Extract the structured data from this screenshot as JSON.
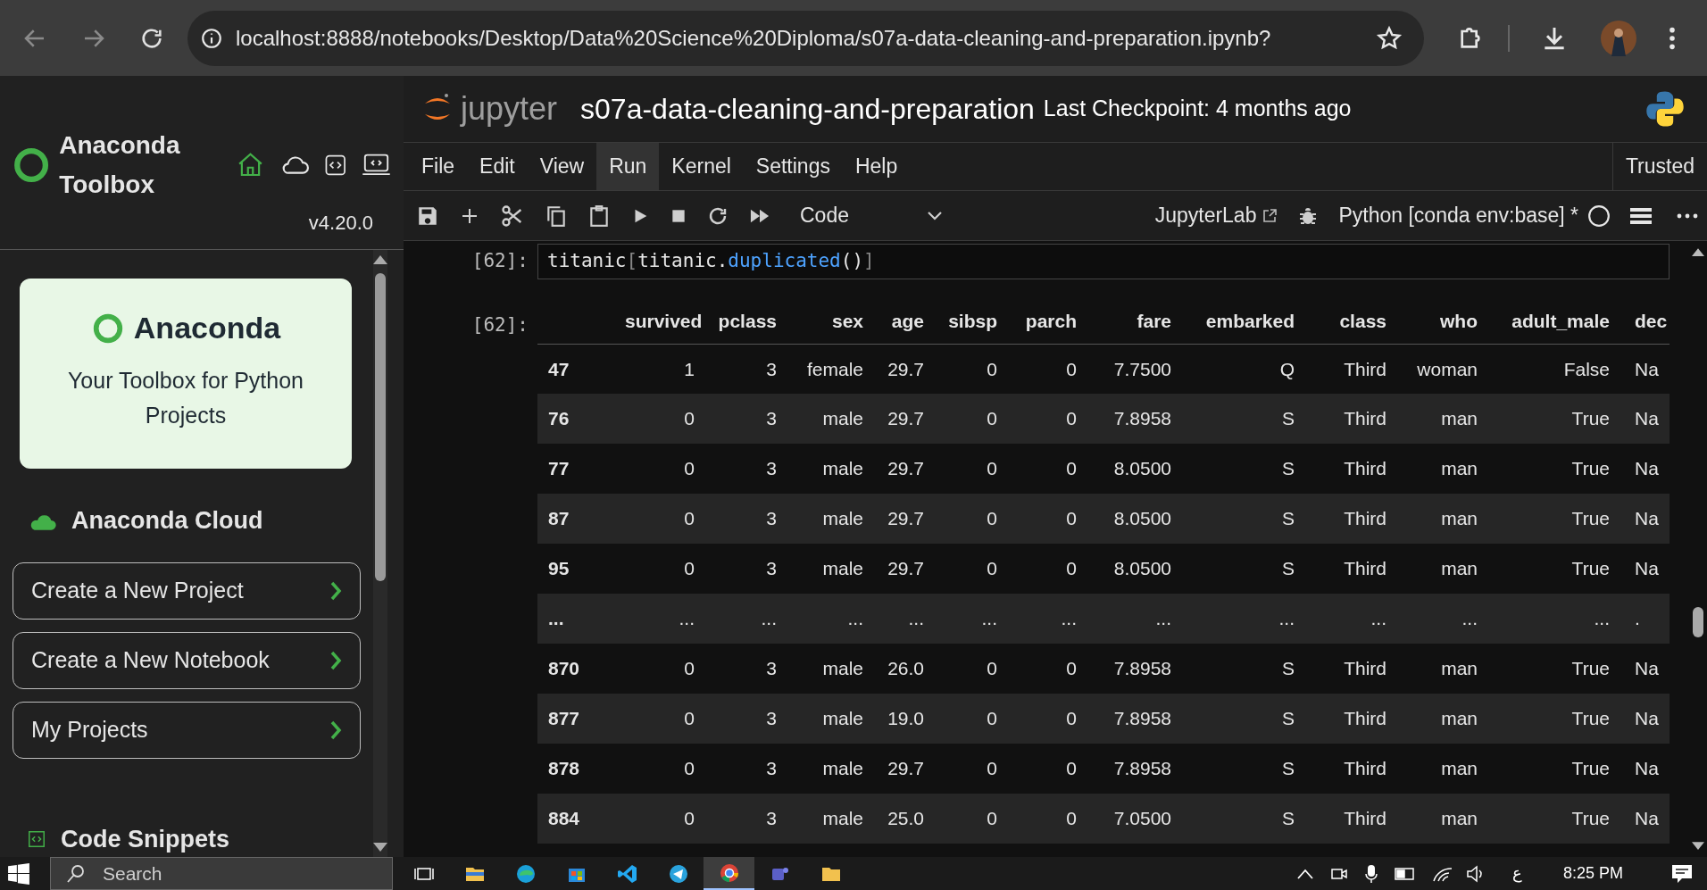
{
  "browser": {
    "url": "localhost:8888/notebooks/Desktop/Data%20Science%20Diploma/s07a-data-cleaning-and-preparation.ipynb?"
  },
  "sidebar": {
    "title": "Anaconda Toolbox",
    "version": "v4.20.0",
    "card": {
      "brand": "Anaconda",
      "tagline": "Your Toolbox for Python Projects"
    },
    "cloud_heading": "Anaconda Cloud",
    "actions": [
      "Create a New Project",
      "Create a New Notebook",
      "My Projects"
    ],
    "snippets_heading": "Code Snippets"
  },
  "notebook": {
    "logo": "jupyter",
    "title": "s07a-data-cleaning-and-preparation",
    "checkpoint": "Last Checkpoint: 4 months ago",
    "menu": [
      {
        "label": "File",
        "selected": false
      },
      {
        "label": "Edit",
        "selected": false
      },
      {
        "label": "View",
        "selected": false
      },
      {
        "label": "Run",
        "selected": true
      },
      {
        "label": "Kernel",
        "selected": false
      },
      {
        "label": "Settings",
        "selected": false
      },
      {
        "label": "Help",
        "selected": false
      }
    ],
    "trusted": "Trusted",
    "cell_type": "Code",
    "jupyterlab": "JupyterLab",
    "kernel": "Python [conda env:base] *",
    "input_prompt": "[62]:",
    "code": [
      {
        "t": "titanic",
        "kind": "name"
      },
      {
        "t": "[",
        "kind": "bracket"
      },
      {
        "t": "titanic.",
        "kind": "name"
      },
      {
        "t": "duplicated",
        "kind": "method"
      },
      {
        "t": "()",
        "kind": "name"
      },
      {
        "t": "]",
        "kind": "bracket"
      }
    ],
    "output_prompt": "[62]:",
    "table": {
      "columns": [
        "",
        "survived",
        "pclass",
        "sex",
        "age",
        "sibsp",
        "parch",
        "fare",
        "embarked",
        "class",
        "who",
        "adult_male",
        "dec"
      ],
      "rows": [
        [
          "47",
          "1",
          "3",
          "female",
          "29.7",
          "0",
          "0",
          "7.7500",
          "Q",
          "Third",
          "woman",
          "False",
          "Na"
        ],
        [
          "76",
          "0",
          "3",
          "male",
          "29.7",
          "0",
          "0",
          "7.8958",
          "S",
          "Third",
          "man",
          "True",
          "Na"
        ],
        [
          "77",
          "0",
          "3",
          "male",
          "29.7",
          "0",
          "0",
          "8.0500",
          "S",
          "Third",
          "man",
          "True",
          "Na"
        ],
        [
          "87",
          "0",
          "3",
          "male",
          "29.7",
          "0",
          "0",
          "8.0500",
          "S",
          "Third",
          "man",
          "True",
          "Na"
        ],
        [
          "95",
          "0",
          "3",
          "male",
          "29.7",
          "0",
          "0",
          "8.0500",
          "S",
          "Third",
          "man",
          "True",
          "Na"
        ],
        [
          "...",
          "...",
          "...",
          "...",
          "...",
          "...",
          "...",
          "...",
          "...",
          "...",
          "...",
          "...",
          "."
        ],
        [
          "870",
          "0",
          "3",
          "male",
          "26.0",
          "0",
          "0",
          "7.8958",
          "S",
          "Third",
          "man",
          "True",
          "Na"
        ],
        [
          "877",
          "0",
          "3",
          "male",
          "19.0",
          "0",
          "0",
          "7.8958",
          "S",
          "Third",
          "man",
          "True",
          "Na"
        ],
        [
          "878",
          "0",
          "3",
          "male",
          "29.7",
          "0",
          "0",
          "7.8958",
          "S",
          "Third",
          "man",
          "True",
          "Na"
        ],
        [
          "884",
          "0",
          "3",
          "male",
          "25.0",
          "0",
          "0",
          "7.0500",
          "S",
          "Third",
          "man",
          "True",
          "Na"
        ]
      ]
    }
  },
  "taskbar": {
    "search_placeholder": "Search",
    "apps": [
      {
        "kind": "taskview",
        "selected": false
      },
      {
        "kind": "files",
        "selected": false
      },
      {
        "kind": "edge",
        "selected": false
      },
      {
        "kind": "store",
        "selected": false
      },
      {
        "kind": "vscode",
        "selected": false
      },
      {
        "kind": "telegram",
        "selected": false
      },
      {
        "kind": "chrome",
        "selected": true
      },
      {
        "kind": "teams",
        "selected": false
      },
      {
        "kind": "folder",
        "selected": false
      }
    ],
    "language": "ع",
    "time": "8:25 PM"
  }
}
